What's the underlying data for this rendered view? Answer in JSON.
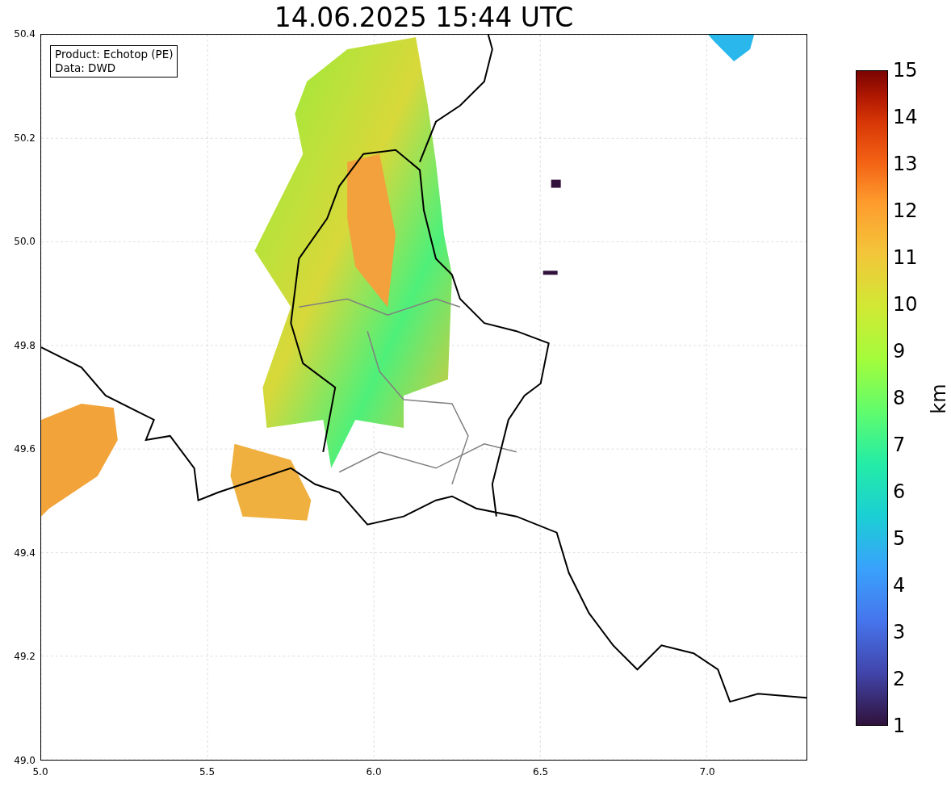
{
  "title": "14.06.2025 15:44 UTC",
  "info_box": [
    "Product: Echotop (PE)",
    "Data: DWD"
  ],
  "map": {
    "x_ticks": [
      "5.0",
      "5.5",
      "6.0",
      "6.5",
      "7.0"
    ],
    "y_ticks": [
      "50.4",
      "50.2",
      "50.0",
      "49.8",
      "49.6",
      "49.4",
      "49.2",
      "49.0"
    ]
  },
  "colorbar": {
    "label": "km",
    "ticks": [
      "15",
      "14",
      "13",
      "12",
      "11",
      "10",
      "9",
      "8",
      "7",
      "6",
      "5",
      "4",
      "3",
      "2",
      "1"
    ]
  }
}
